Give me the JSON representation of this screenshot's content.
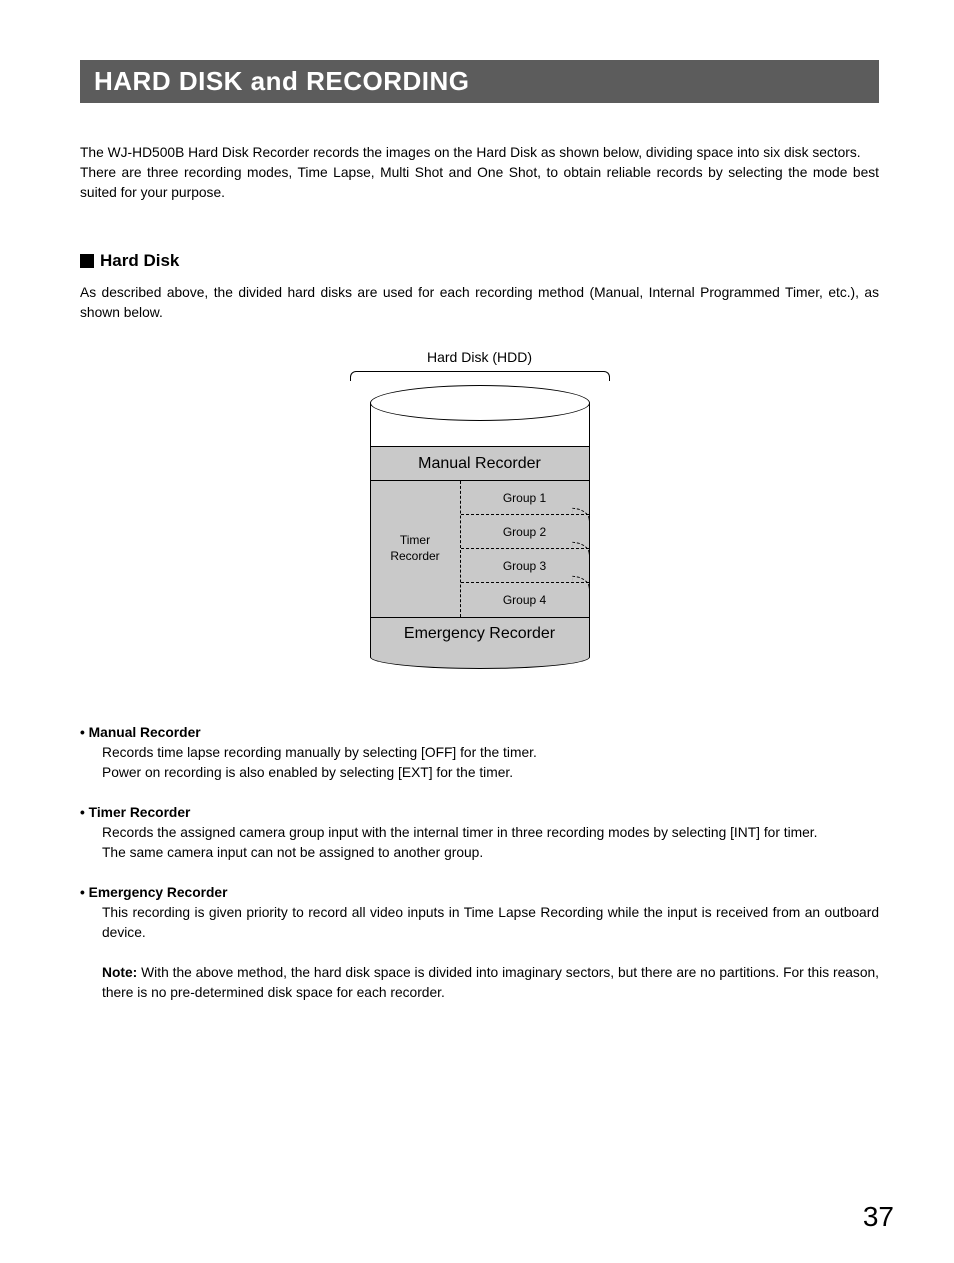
{
  "title": "HARD DISK and RECORDING",
  "intro": "The WJ-HD500B Hard Disk Recorder records the images on the Hard Disk as shown below, dividing space into six disk sectors.\nThere are three recording modes, Time Lapse, Multi Shot and One Shot, to obtain reliable records by selecting the mode best suited for your purpose.",
  "section1": {
    "heading": "Hard Disk",
    "text": "As described above, the divided hard disks are used for each recording method (Manual, Internal Programmed Timer, etc.), as shown below."
  },
  "diagram": {
    "label": "Hard Disk (HDD)",
    "manual": "Manual Recorder",
    "timer": "Timer\nRecorder",
    "groups": [
      "Group 1",
      "Group 2",
      "Group 3",
      "Group 4"
    ],
    "emergency": "Emergency Recorder"
  },
  "descriptions": [
    {
      "head": "Manual Recorder",
      "body": "Records time lapse recording manually by selecting [OFF] for the timer.\nPower on recording is also enabled by selecting [EXT] for the timer."
    },
    {
      "head": "Timer Recorder",
      "body": "Records the assigned camera group input with the internal timer in three recording modes by selecting [INT] for timer.\nThe same camera input can not be assigned to another group."
    },
    {
      "head": "Emergency Recorder",
      "body": "This recording is given priority to record all video inputs in Time Lapse Recording while the input is received from an outboard device."
    }
  ],
  "note_label": "Note:",
  "note_text": "With the above method, the hard disk space is divided into imaginary sectors, but there are no partitions. For this reason, there is no pre-determined disk space for each recorder.",
  "page_number": "37"
}
